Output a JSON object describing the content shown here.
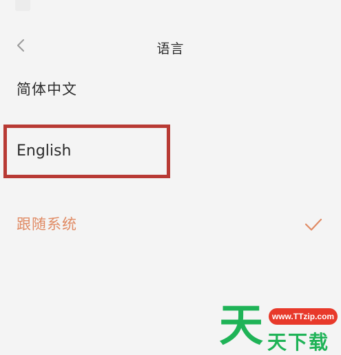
{
  "header": {
    "title": "语言",
    "back_icon": "chevron-left-icon"
  },
  "languages": [
    {
      "label": "简体中文",
      "selected": false
    },
    {
      "label": "English",
      "selected": false,
      "highlighted": true
    },
    {
      "label": "跟随系统",
      "selected": true
    }
  ],
  "selected_icon": "checkmark-icon",
  "colors": {
    "background": "#f4f4f4",
    "accent": "#e08a63",
    "highlight_border": "#b83a34",
    "watermark_green": "#1fb357",
    "watermark_red": "#e8392a"
  },
  "watermark": {
    "url": "www.TTzip.com",
    "big_char": "天",
    "text": "天下载"
  }
}
